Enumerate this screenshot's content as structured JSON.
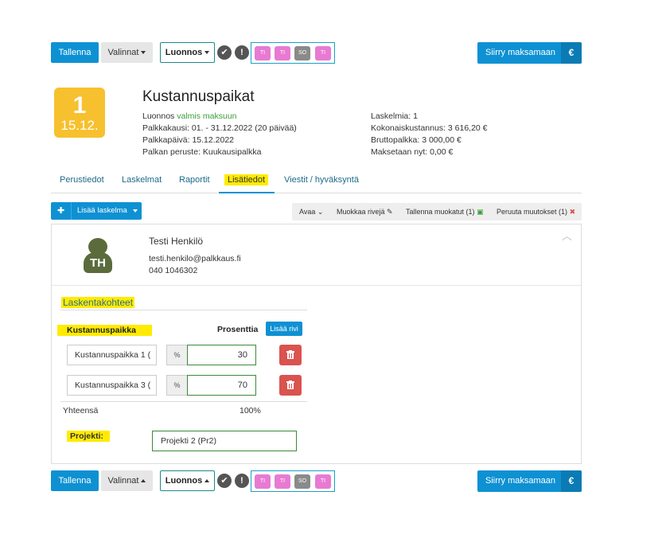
{
  "top_bar": {
    "save": "Tallenna",
    "options": "Valinnat",
    "status": "Luonnos",
    "chips": [
      {
        "text": "TI",
        "color": "#e87ad3"
      },
      {
        "text": "TI",
        "color": "#e87ad3"
      },
      {
        "text": "SO",
        "color": "#8a8a8a"
      },
      {
        "text": "TI",
        "color": "#e87ad3"
      }
    ],
    "pay": "Siirry maksamaan",
    "currency": "€",
    "check_icon": "check-circle-icon",
    "alert_icon": "exclamation-circle-icon"
  },
  "badge": {
    "day": "1",
    "date": "15.12."
  },
  "header": {
    "title": "Kustannuspaikat",
    "status_prefix": "Luonnos",
    "status_text": "valmis maksuun",
    "period": "Palkkakausi: 01. - 31.12.2022 (20 päivää)",
    "pay_day": "Palkkapäivä: 15.12.2022",
    "basis": "Palkan peruste: Kuukausipalkka",
    "calculations": "Laskelmia: 1",
    "total_cost": "Kokonaiskustannus: 3 616,20 €",
    "gross": "Bruttopalkka: 3 000,00 €",
    "paid_now": "Maksetaan nyt: 0,00 €"
  },
  "tabs": [
    {
      "label": "Perustiedot"
    },
    {
      "label": "Laskelmat"
    },
    {
      "label": "Raportit"
    },
    {
      "label": "Lisätiedot"
    },
    {
      "label": "Viestit / hyväksyntä"
    }
  ],
  "toolbar": {
    "add_calc": "Lisää laskelma",
    "open": "Avaa",
    "edit_rows": "Muokkaa rivejä",
    "save_changes": "Tallenna muokatut (1)",
    "cancel_changes": "Peruuta muutokset (1)"
  },
  "person": {
    "initials": "TH",
    "name": "Testi Henkilö",
    "email": "testi.henkilo@palkkaus.fi",
    "phone": "040 1046302"
  },
  "cost_centers": {
    "section_title": "Laskentakohteet",
    "col_center": "Kustannuspaikka",
    "col_percent": "Prosenttia",
    "add_row": "Lisää rivi",
    "rows": [
      {
        "name": "Kustannuspaikka 1 (",
        "unit": "%",
        "value": "30"
      },
      {
        "name": "Kustannuspaikka 3 (",
        "unit": "%",
        "value": "70"
      }
    ],
    "total_label": "Yhteensä",
    "total_value": "100%",
    "project_label": "Projekti:",
    "project_value": "Projekti 2 (Pr2)"
  }
}
